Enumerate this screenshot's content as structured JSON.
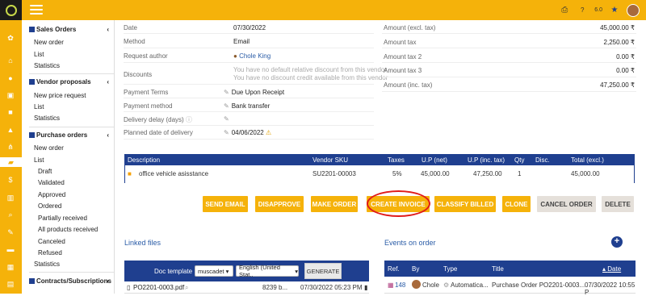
{
  "header": {
    "version": "6.0"
  },
  "sidebar": {
    "sales_orders": {
      "title": "Sales Orders",
      "items": [
        "New order",
        "List",
        "Statistics"
      ]
    },
    "vendor_proposals": {
      "title": "Vendor proposals",
      "items": [
        "New price request",
        "List",
        "Statistics"
      ]
    },
    "purchase_orders": {
      "title": "Purchase orders",
      "items": [
        "New order",
        "List"
      ],
      "subitems": [
        "Draft",
        "Validated",
        "Approved",
        "Ordered",
        "Partially received",
        "All products received",
        "Canceled",
        "Refused"
      ],
      "after": [
        "Statistics"
      ]
    },
    "contracts": {
      "title": "Contracts/Subscriptions"
    }
  },
  "details": {
    "date_label": "Date",
    "date": "07/30/2022",
    "method_label": "Method",
    "method": "Email",
    "author_label": "Request author",
    "author": "Chole King",
    "discounts_label": "Discounts",
    "discount_line1": "You have no default relative discount from this vendor",
    "discount_line2": "You have no discount credit available from this vendor",
    "terms_label": "Payment Terms",
    "terms": "Due Upon Receipt",
    "pmethod_label": "Payment method",
    "pmethod": "Bank transfer",
    "delay_label": "Delivery delay (days)",
    "planned_label": "Planned date of delivery",
    "planned": "04/06/2022"
  },
  "amounts": {
    "excl_label": "Amount (excl. tax)",
    "excl": "45,000.00 ₹",
    "tax_label": "Amount tax",
    "tax": "2,250.00 ₹",
    "tax2_label": "Amount tax 2",
    "tax2": "0.00 ₹",
    "tax3_label": "Amount tax 3",
    "tax3": "0.00 ₹",
    "inc_label": "Amount (inc. tax)",
    "inc": "47,250.00 ₹"
  },
  "lines": {
    "headers": {
      "desc": "Description",
      "sku": "Vendor SKU",
      "taxes": "Taxes",
      "upnet": "U.P (net)",
      "upinc": "U.P (inc. tax)",
      "qty": "Qty",
      "disc": "Disc.",
      "total": "Total (excl.)"
    },
    "row": {
      "desc": "office vehicle asisstance",
      "sku": "SU2201-00003",
      "taxes": "5%",
      "upnet": "45,000.00",
      "upinc": "47,250.00",
      "qty": "1",
      "disc": "",
      "total": "45,000.00"
    }
  },
  "actions": [
    "SEND EMAIL",
    "DISAPPROVE",
    "MAKE ORDER",
    "CREATE INVOICE",
    "CLASSIFY BILLED",
    "CLONE",
    "CANCEL ORDER",
    "DELETE"
  ],
  "linked": {
    "title": "Linked files",
    "doc_template_label": "Doc template",
    "template": "muscadet",
    "lang": "English (United Stat..",
    "generate": "GENERATE",
    "file": "PO2201-0003.pdf",
    "size": "8239 b...",
    "fdate": "07/30/2022 05:23 PM"
  },
  "events": {
    "title": "Events on order",
    "headers": {
      "ref": "Ref.",
      "by": "By",
      "type": "Type",
      "title": "Title",
      "date": "Date"
    },
    "row": {
      "ref": "148",
      "by": "Chole",
      "type": "Automatica...",
      "title": "Purchase Order PO2201-0003...",
      "date": "07/30/2022 10:55 P"
    }
  }
}
